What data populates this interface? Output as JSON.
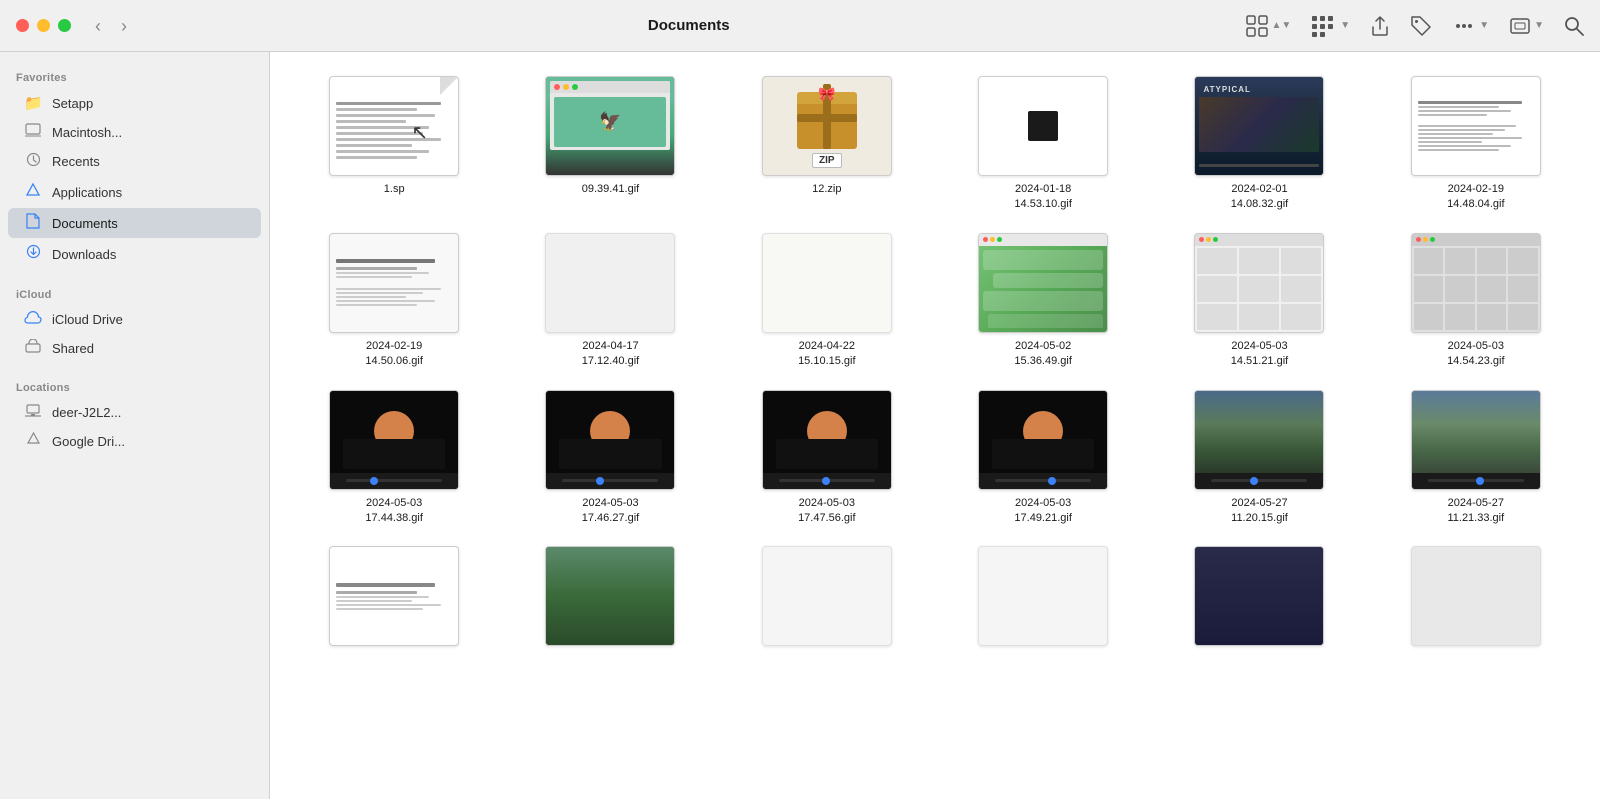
{
  "titleBar": {
    "title": "Documents",
    "backLabel": "‹",
    "forwardLabel": "›"
  },
  "sidebar": {
    "sections": [
      {
        "label": "Favorites",
        "items": [
          {
            "id": "setapp",
            "icon": "📁",
            "iconType": "blue",
            "label": "Setapp"
          },
          {
            "id": "macintosh",
            "icon": "💾",
            "iconType": "gray",
            "label": "Macintosh..."
          },
          {
            "id": "recents",
            "icon": "🕐",
            "iconType": "gray",
            "label": "Recents"
          },
          {
            "id": "applications",
            "icon": "✦",
            "iconType": "blue",
            "label": "Applications"
          },
          {
            "id": "documents",
            "icon": "📄",
            "iconType": "blue",
            "label": "Documents",
            "active": true
          },
          {
            "id": "downloads",
            "icon": "⬇",
            "iconType": "blue",
            "label": "Downloads"
          }
        ]
      },
      {
        "label": "iCloud",
        "items": [
          {
            "id": "icloud-drive",
            "icon": "☁",
            "iconType": "blue",
            "label": "iCloud Drive"
          },
          {
            "id": "shared",
            "icon": "🗂",
            "iconType": "gray",
            "label": "Shared"
          }
        ]
      },
      {
        "label": "Locations",
        "items": [
          {
            "id": "deer",
            "icon": "💻",
            "iconType": "gray",
            "label": "deer-J2L2..."
          },
          {
            "id": "google-drive",
            "icon": "△",
            "iconType": "gray",
            "label": "Google Dri..."
          }
        ]
      }
    ]
  },
  "files": [
    {
      "id": "f1",
      "name": "1.sp",
      "type": "document-fold"
    },
    {
      "id": "f2",
      "name": "09.39.41.gif",
      "type": "screenshot-gif"
    },
    {
      "id": "f3",
      "name": "12.zip",
      "type": "zip"
    },
    {
      "id": "f4",
      "name": "2024-01-18\n14.53.10.gif",
      "type": "blank-white"
    },
    {
      "id": "f5",
      "name": "2024-02-01\n14.08.32.gif",
      "type": "movie-screenshot"
    },
    {
      "id": "f6",
      "name": "2024-02-19\n14.48.04.gif",
      "type": "text-document"
    },
    {
      "id": "f7",
      "name": "2024-02-19\n14.50.06.gif",
      "type": "text-list"
    },
    {
      "id": "f8",
      "name": "2024-04-17\n17.12.40.gif",
      "type": "blank-light"
    },
    {
      "id": "f9",
      "name": "2024-04-22\n15.10.15.gif",
      "type": "blank-offwhite"
    },
    {
      "id": "f10",
      "name": "2024-05-02\n15.36.49.gif",
      "type": "green-chat"
    },
    {
      "id": "f11",
      "name": "2024-05-03\n14.51.21.gif",
      "type": "ui-grid"
    },
    {
      "id": "f12",
      "name": "2024-05-03\n14.54.23.gif",
      "type": "ui-grid2"
    },
    {
      "id": "f13",
      "name": "2024-05-03\n17.44.38.gif",
      "type": "video-dark"
    },
    {
      "id": "f14",
      "name": "2024-05-03\n17.46.27.gif",
      "type": "video-dark"
    },
    {
      "id": "f15",
      "name": "2024-05-03\n17.47.56.gif",
      "type": "video-dark"
    },
    {
      "id": "f16",
      "name": "2024-05-03\n17.49.21.gif",
      "type": "video-dark"
    },
    {
      "id": "f17",
      "name": "2024-05-27\n11.20.15.gif",
      "type": "video-outdoor"
    },
    {
      "id": "f18",
      "name": "2024-05-27\n11.21.33.gif",
      "type": "video-outdoor2"
    },
    {
      "id": "f19",
      "name": "",
      "type": "text-list2"
    },
    {
      "id": "f20",
      "name": "",
      "type": "nature-screenshot"
    },
    {
      "id": "f21",
      "name": "",
      "type": "blank-row"
    },
    {
      "id": "f22",
      "name": "",
      "type": "blank-row"
    },
    {
      "id": "f23",
      "name": "",
      "type": "dark-screenshot"
    },
    {
      "id": "f24",
      "name": "",
      "type": "blank-row2"
    }
  ]
}
